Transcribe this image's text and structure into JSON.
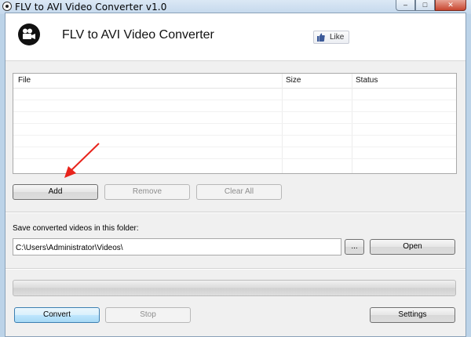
{
  "window": {
    "title": "FLV to AVI Video Converter v1.0"
  },
  "header": {
    "app_title": "FLV to AVI Video Converter",
    "like_label": "Like"
  },
  "file_list": {
    "columns": [
      "File",
      "Size",
      "Status"
    ],
    "rows": []
  },
  "buttons": {
    "add": "Add",
    "remove": "Remove",
    "clear_all": "Clear All",
    "browse": "...",
    "open": "Open",
    "convert": "Convert",
    "stop": "Stop",
    "settings": "Settings"
  },
  "output": {
    "label": "Save converted videos in this folder:",
    "folder": "C:\\Users\\Administrator\\Videos\\"
  },
  "progress": {
    "value": 0
  },
  "colors": {
    "annotation_arrow": "#e8241c",
    "focus_border": "#3c7fb1"
  }
}
